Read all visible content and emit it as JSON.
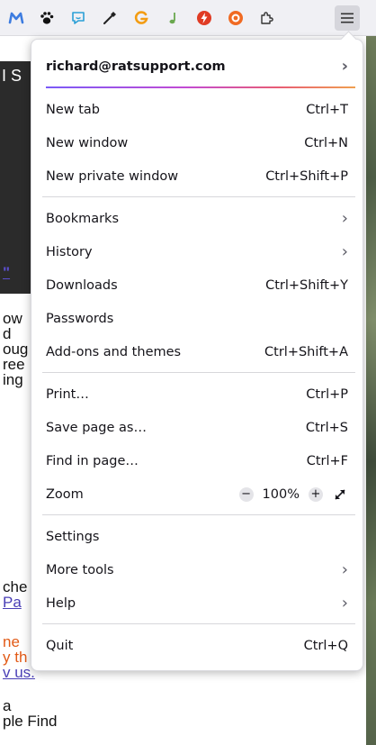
{
  "toolbar": {
    "icons": [
      {
        "name": "m-logo-icon",
        "color": "#3d7ce0"
      },
      {
        "name": "paw-icon",
        "color": "#111111"
      },
      {
        "name": "chat-face-icon",
        "color": "#2a9fd6"
      },
      {
        "name": "eyedropper-icon",
        "color": "#222222"
      },
      {
        "name": "g-orange-icon",
        "color": "#f39c12"
      },
      {
        "name": "music-note-icon",
        "color": "#6aa84f"
      },
      {
        "name": "lightning-icon",
        "color": "#e03b24"
      },
      {
        "name": "donut-icon",
        "color": "#f06a22"
      },
      {
        "name": "extensions-puzzle-icon",
        "color": "#333333"
      },
      {
        "name": "hamburger-menu-icon",
        "color": "#333333"
      }
    ]
  },
  "background_page": {
    "dark_text": "I S",
    "fragments": [
      {
        "text": "\"",
        "style": "quote"
      },
      {
        "text": "ow",
        "style": ""
      },
      {
        "text": "d",
        "style": ""
      },
      {
        "text": "oug",
        "style": ""
      },
      {
        "text": "ree",
        "style": ""
      },
      {
        "text": "ing",
        "style": ""
      },
      {
        "text": "che",
        "style": ""
      },
      {
        "text": "Pa",
        "style": "link"
      },
      {
        "text": "ne",
        "style": "orange"
      },
      {
        "text": "y th",
        "style": "orange"
      },
      {
        "text": "v us.",
        "style": "link"
      },
      {
        "text": "a",
        "style": ""
      },
      {
        "text": "ple Find",
        "style": ""
      }
    ]
  },
  "menu": {
    "account": {
      "label": "richard@ratsupport.com"
    },
    "items": [
      {
        "label": "New tab",
        "shortcut": "Ctrl+T"
      },
      {
        "label": "New window",
        "shortcut": "Ctrl+N"
      },
      {
        "label": "New private window",
        "shortcut": "Ctrl+Shift+P"
      },
      {
        "label": "Bookmarks",
        "shortcut": ""
      },
      {
        "label": "History",
        "shortcut": ""
      },
      {
        "label": "Downloads",
        "shortcut": "Ctrl+Shift+Y"
      },
      {
        "label": "Passwords",
        "shortcut": ""
      },
      {
        "label": "Add-ons and themes",
        "shortcut": "Ctrl+Shift+A"
      },
      {
        "label": "Print…",
        "shortcut": "Ctrl+P"
      },
      {
        "label": "Save page as…",
        "shortcut": "Ctrl+S"
      },
      {
        "label": "Find in page…",
        "shortcut": "Ctrl+F"
      },
      {
        "label": "Zoom",
        "shortcut": ""
      },
      {
        "label": "Settings",
        "shortcut": ""
      },
      {
        "label": "More tools",
        "shortcut": ""
      },
      {
        "label": "Help",
        "shortcut": ""
      },
      {
        "label": "Quit",
        "shortcut": "Ctrl+Q"
      }
    ],
    "zoom": {
      "value": "100%",
      "minus": "−",
      "plus": "+"
    },
    "chevron": "›"
  }
}
